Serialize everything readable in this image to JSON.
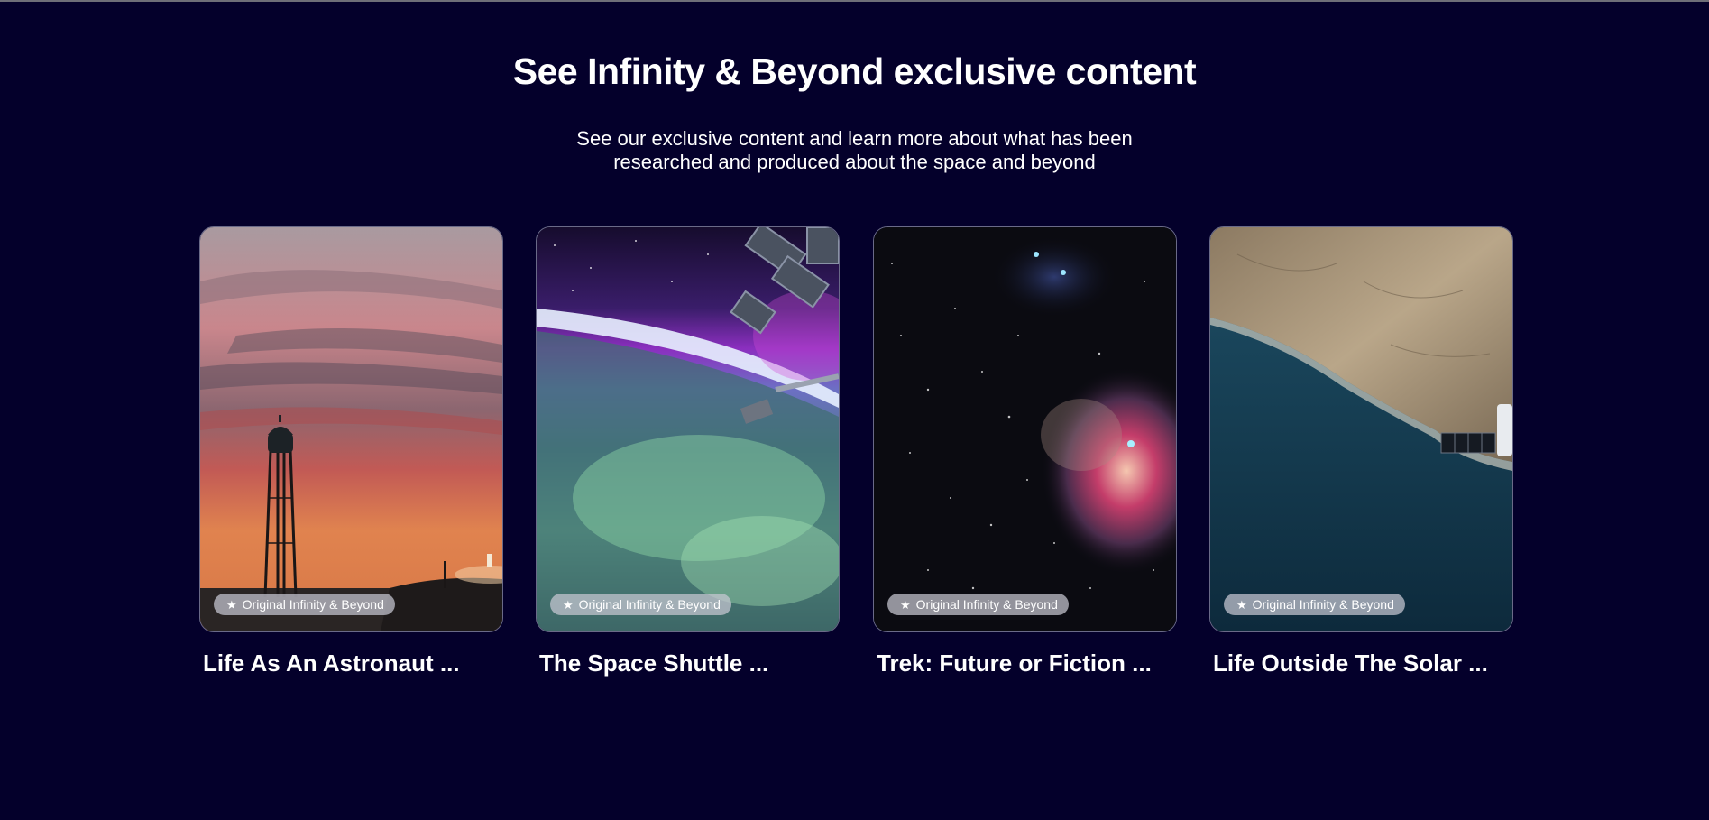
{
  "section": {
    "heading": "See Infinity & Beyond exclusive content",
    "subheading": "See our exclusive content and learn more about what has been researched and produced about the space and beyond"
  },
  "cards": [
    {
      "title": "Life As An Astronaut ...",
      "badge": "Original Infinity & Beyond",
      "badge_icon": "star-icon",
      "image": "water-tower-sunset-image"
    },
    {
      "title": "The Space Shuttle ...",
      "badge": "Original Infinity & Beyond",
      "badge_icon": "star-icon",
      "image": "space-station-aurora-image"
    },
    {
      "title": "Trek: Future or Fiction ...",
      "badge": "Original Infinity & Beyond",
      "badge_icon": "star-icon",
      "image": "orion-nebula-image"
    },
    {
      "title": "Life Outside The Solar ...",
      "badge": "Original Infinity & Beyond",
      "badge_icon": "star-icon",
      "image": "earth-coastline-satellite-image"
    }
  ],
  "colors": {
    "background": "#04002b",
    "text": "#ffffff",
    "card_border": "#6a6a88",
    "badge_background": "#c8c8d2"
  }
}
